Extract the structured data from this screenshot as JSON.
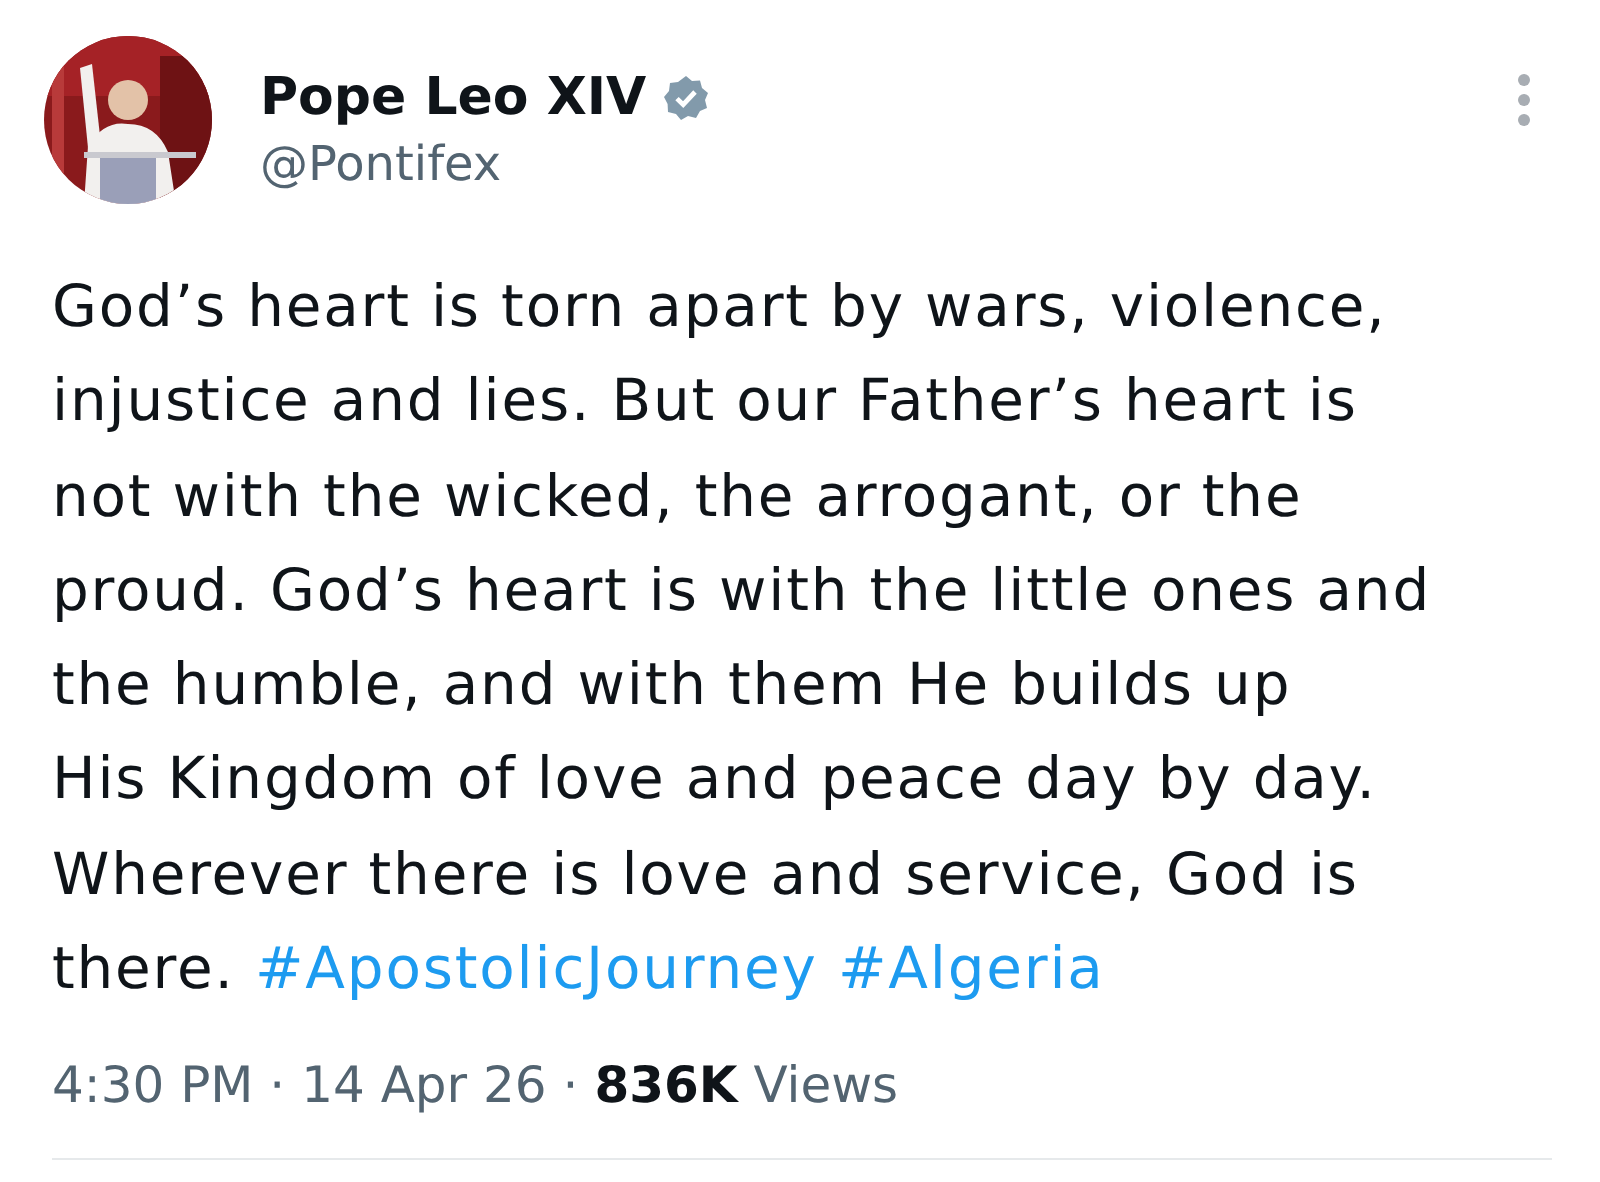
{
  "author": {
    "name": "Pope Leo XIV",
    "verified": true,
    "handle": "@Pontifex"
  },
  "body": {
    "lines": [
      "God’s heart is torn apart by wars, violence,",
      "injustice and lies. But our Father’s heart is",
      "not with the wicked, the arrogant, or the",
      "proud. God’s heart is with the little ones and",
      "the humble, and with them He builds up",
      "His Kingdom of love and peace day by day.",
      "Wherever there is love and service, God is",
      "there."
    ],
    "hashtags": [
      "#ApostolicJourney",
      "#Algeria"
    ]
  },
  "meta": {
    "time": "4:30 PM",
    "separator": "·",
    "date": "14 Apr 26",
    "views_count": "836K",
    "views_label": "Views"
  }
}
